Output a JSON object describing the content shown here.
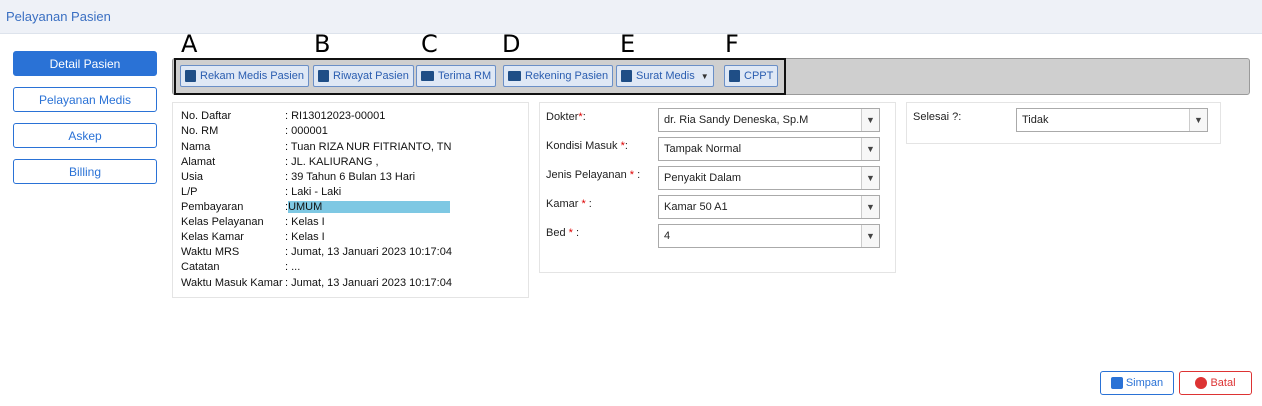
{
  "window": {
    "title": "Pelayanan Pasien"
  },
  "sidebar": {
    "items": [
      {
        "label": "Detail Pasien",
        "active": true
      },
      {
        "label": "Pelayanan Medis"
      },
      {
        "label": "Askep"
      },
      {
        "label": "Billing"
      }
    ]
  },
  "annotations": {
    "a": "A",
    "b": "B",
    "c": "C",
    "d": "D",
    "e": "E",
    "f": "F"
  },
  "toolbar": {
    "rekam_medis": "Rekam Medis Pasien",
    "riwayat": "Riwayat Pasien",
    "terima_rm": "Terima RM",
    "rekening": "Rekening Pasien",
    "surat_medis": "Surat Medis",
    "cppt": "CPPT"
  },
  "patient": {
    "no_daftar_label": "No. Daftar",
    "no_daftar": ": RI13012023-00001",
    "no_rm_label": "No. RM",
    "no_rm": ": 000001",
    "nama_label": "Nama",
    "nama": ": Tuan RIZA NUR FITRIANTO, TN",
    "alamat_label": "Alamat",
    "alamat": ": JL. KALIURANG ,",
    "usia_label": "Usia",
    "usia": ": 39 Tahun 6 Bulan 13 Hari",
    "lp_label": "L/P",
    "lp": ": Laki - Laki",
    "pembayaran_label": "Pembayaran",
    "pembayaran_sep": ":",
    "pembayaran": "UMUM",
    "kelas_pelayanan_label": "Kelas Pelayanan",
    "kelas_pelayanan": ": Kelas I",
    "kelas_kamar_label": "Kelas Kamar",
    "kelas_kamar": ": Kelas I",
    "waktu_mrs_label": "Waktu MRS",
    "waktu_mrs": ": Jumat, 13 Januari 2023 10:17:04",
    "catatan_label": "Catatan",
    "catatan": ": ...",
    "waktu_masuk_label": "Waktu Masuk Kamar",
    "waktu_masuk": ": Jumat, 13 Januari 2023 10:17:04"
  },
  "form": {
    "dokter_label": "Dokter",
    "dokter_req": "*",
    "dokter_colon": ":",
    "dokter": "dr. Ria Sandy Deneska, Sp.M",
    "kondisi_label": "Kondisi Masuk ",
    "kondisi_req": "*",
    "kondisi_colon": ":",
    "kondisi": "Tampak Normal",
    "jenis_label": "Jenis Pelayanan ",
    "jenis_req": "*",
    "jenis_colon": " :",
    "jenis": "Penyakit Dalam",
    "kamar_label": "Kamar ",
    "kamar_req": "*",
    "kamar_colon": " :",
    "kamar": "Kamar 50 A1",
    "bed_label": "Bed ",
    "bed_req": "*",
    "bed_colon": " :",
    "bed": "4"
  },
  "selesai": {
    "label": "Selesai ?:",
    "value": "Tidak"
  },
  "footer": {
    "simpan": "Simpan",
    "batal": "Batal"
  },
  "colors": {
    "accent": "#2a72d6",
    "danger": "#d33333",
    "highlight": "#7ec8e3"
  }
}
